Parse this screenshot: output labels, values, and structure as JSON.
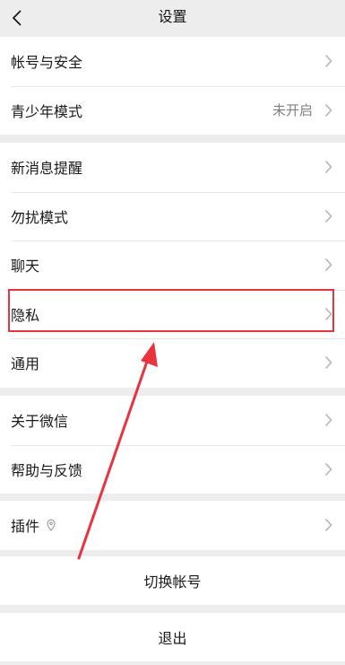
{
  "nav": {
    "title": "设置",
    "back_icon": "chevron-left-icon"
  },
  "groups": [
    {
      "items": [
        {
          "label": "帐号与安全",
          "value": ""
        },
        {
          "label": "青少年模式",
          "value": "未开启"
        }
      ]
    },
    {
      "items": [
        {
          "label": "新消息提醒",
          "value": ""
        },
        {
          "label": "勿扰模式",
          "value": ""
        },
        {
          "label": "聊天",
          "value": ""
        },
        {
          "label": "隐私",
          "value": ""
        },
        {
          "label": "通用",
          "value": ""
        }
      ]
    },
    {
      "items": [
        {
          "label": "关于微信",
          "value": ""
        },
        {
          "label": "帮助与反馈",
          "value": ""
        }
      ]
    },
    {
      "items": [
        {
          "label": "插件",
          "value": "",
          "icon": "location-pin-icon"
        }
      ]
    }
  ],
  "actions": {
    "switch_account": "切换帐号",
    "logout": "退出"
  },
  "colors": {
    "page_bg": "#ededed",
    "row_bg": "#ffffff",
    "annotation": "#e8343f",
    "secondary_text": "#7f7f7f"
  },
  "annotation": {
    "highlighted_item": "隐私"
  }
}
